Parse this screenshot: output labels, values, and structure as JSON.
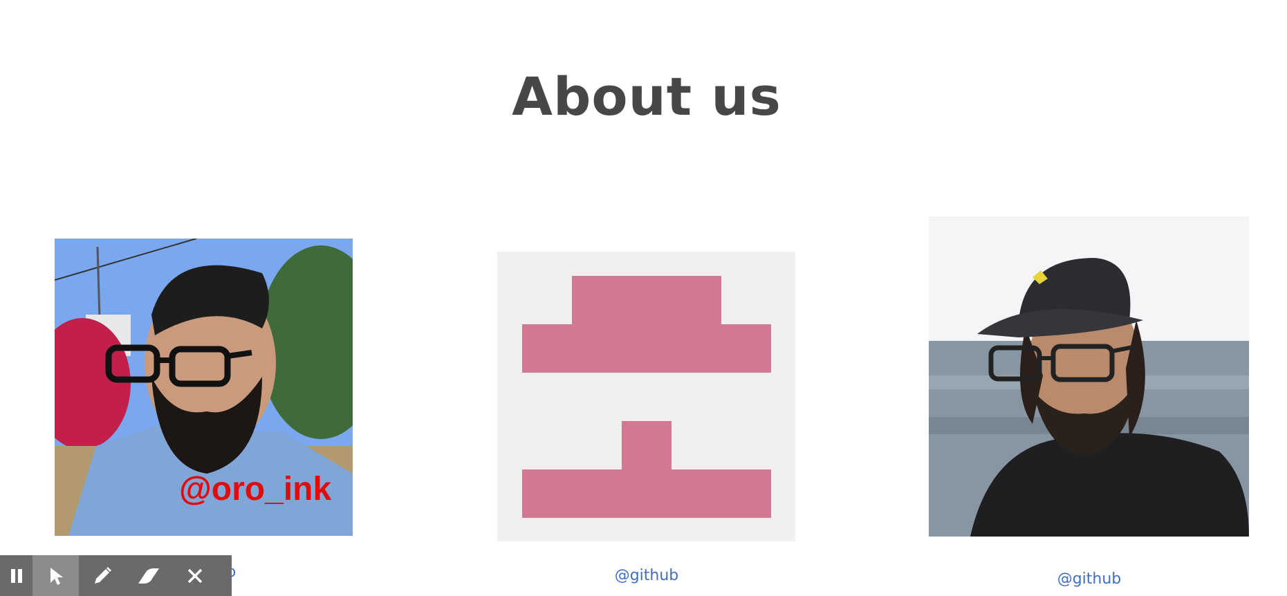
{
  "page": {
    "title": "About us"
  },
  "members": [
    {
      "photo_watermark": "@oro_ink",
      "link_text": "@github"
    },
    {
      "avatar": "identicon",
      "identicon_color": "#d27892",
      "identicon_bg": "#f0f0f0",
      "link_text": "@github"
    },
    {
      "link_text": "@github"
    }
  ],
  "toolbar": {
    "tools": [
      {
        "icon": "pause-icon",
        "active": false
      },
      {
        "icon": "cursor-icon",
        "active": true
      },
      {
        "icon": "pencil-icon",
        "active": false
      },
      {
        "icon": "eraser-icon",
        "active": false
      },
      {
        "icon": "close-icon",
        "active": false
      }
    ]
  },
  "colors": {
    "title": "#474747",
    "link": "#3f6fc4",
    "toolbar_bg": "#6a6a6a",
    "toolbar_active": "#8b8b8b"
  }
}
